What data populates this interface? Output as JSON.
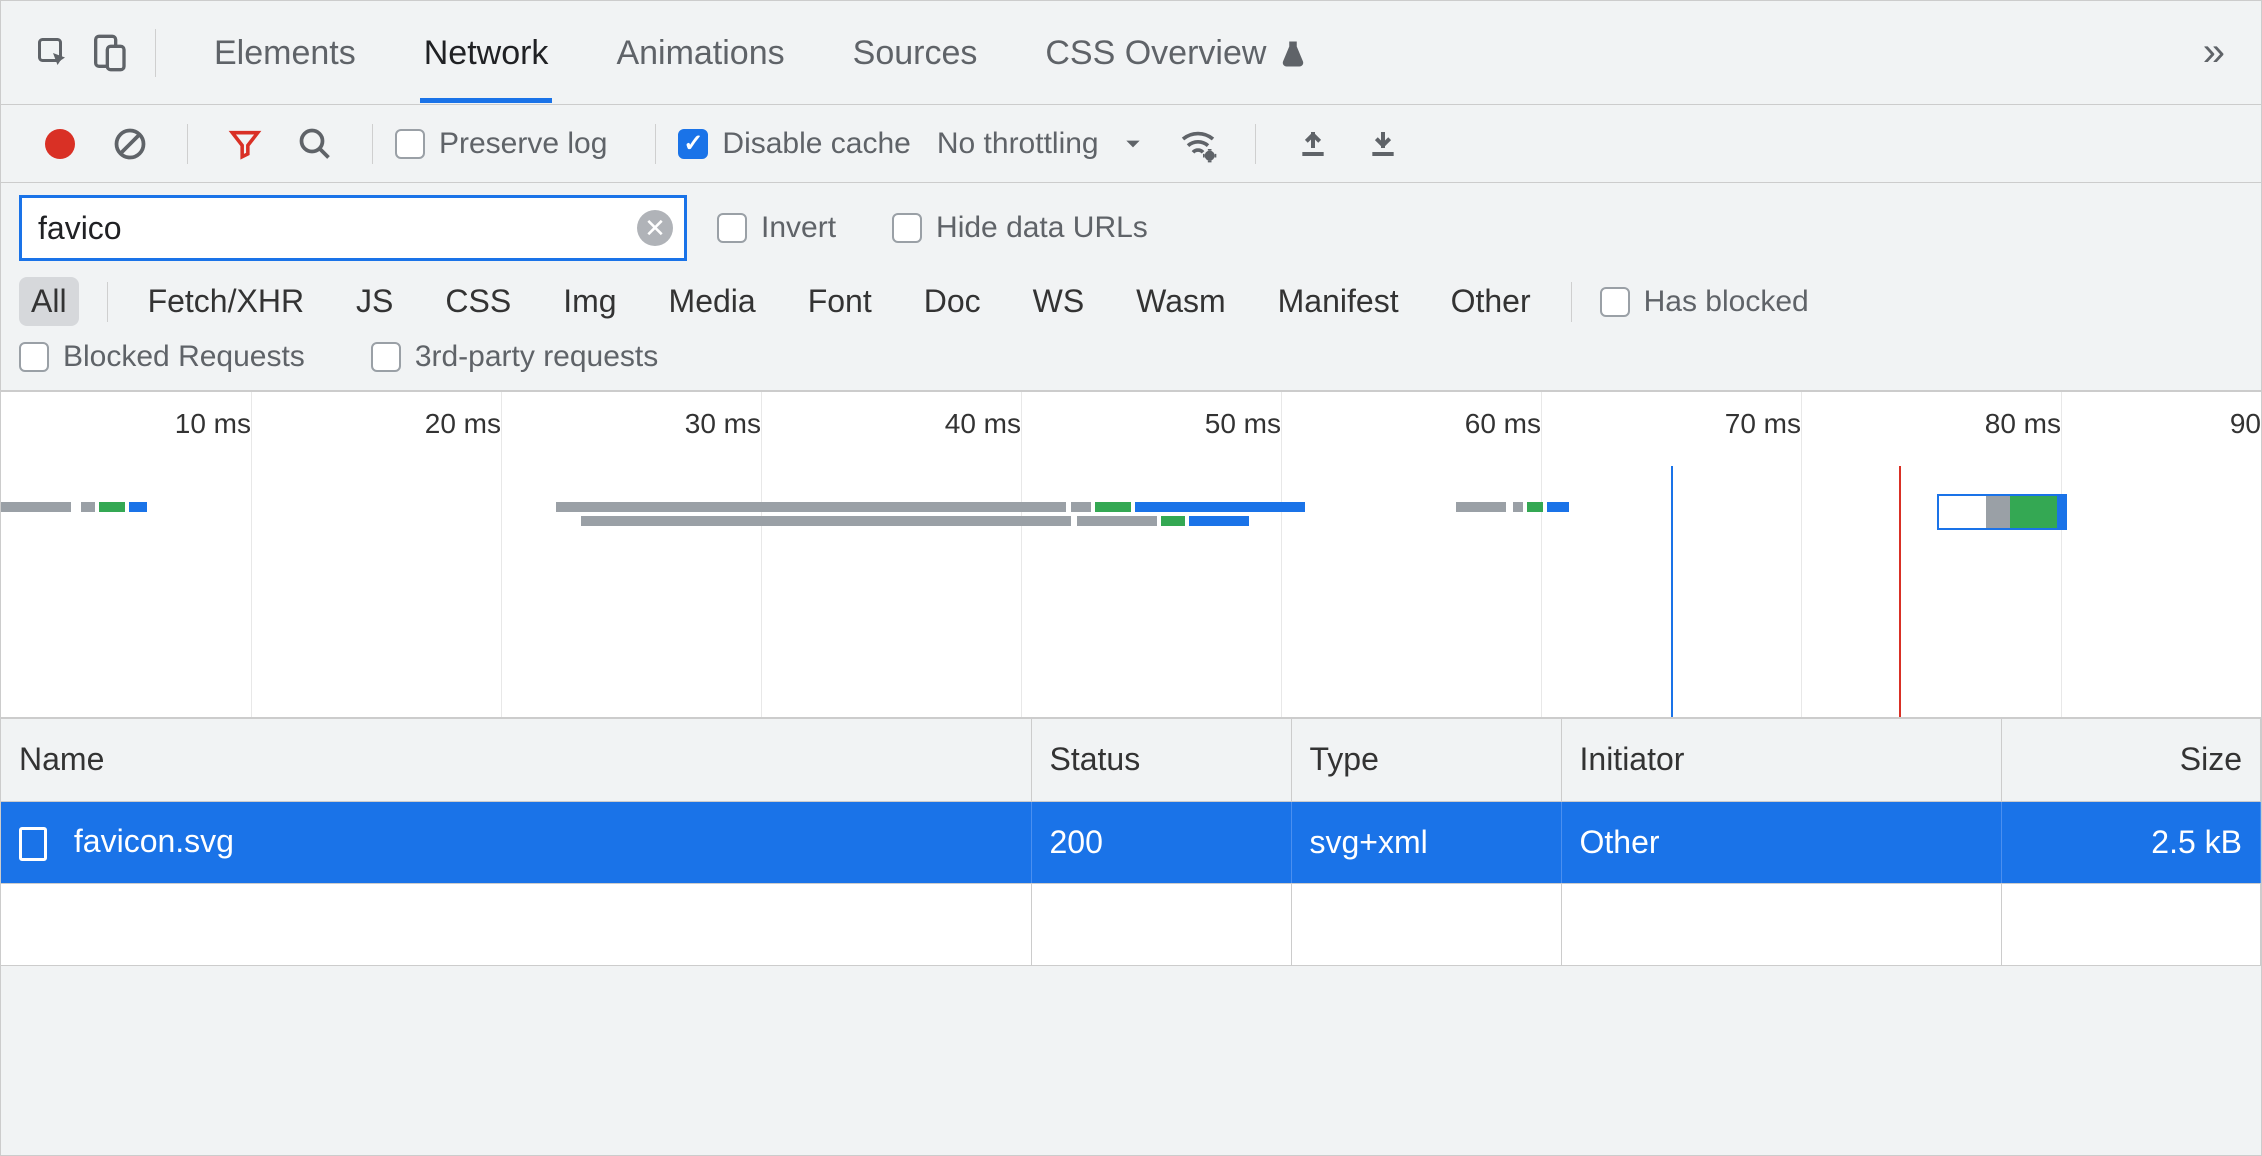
{
  "tabs": {
    "elements": "Elements",
    "network": "Network",
    "animations": "Animations",
    "sources": "Sources",
    "css_overview": "CSS Overview",
    "active": "network"
  },
  "toolbar": {
    "preserve_log_label": "Preserve log",
    "preserve_log_checked": false,
    "disable_cache_label": "Disable cache",
    "disable_cache_checked": true,
    "throttling": "No throttling"
  },
  "filter": {
    "value": "favico",
    "invert_label": "Invert",
    "invert_checked": false,
    "hide_data_urls_label": "Hide data URLs",
    "hide_data_urls_checked": false,
    "types": [
      "All",
      "Fetch/XHR",
      "JS",
      "CSS",
      "Img",
      "Media",
      "Font",
      "Doc",
      "WS",
      "Wasm",
      "Manifest",
      "Other"
    ],
    "type_active": "All",
    "has_blocked_label": "Has blocked",
    "blocked_requests_label": "Blocked Requests",
    "third_party_label": "3rd-party requests"
  },
  "timeline": {
    "ticks": [
      "10 ms",
      "20 ms",
      "30 ms",
      "40 ms",
      "50 ms",
      "60 ms",
      "70 ms",
      "80 ms",
      "90"
    ]
  },
  "table": {
    "columns": {
      "name": "Name",
      "status": "Status",
      "type": "Type",
      "initiator": "Initiator",
      "size": "Size"
    },
    "rows": [
      {
        "name": "favicon.svg",
        "status": "200",
        "type": "svg+xml",
        "initiator": "Other",
        "size": "2.5 kB"
      }
    ]
  }
}
